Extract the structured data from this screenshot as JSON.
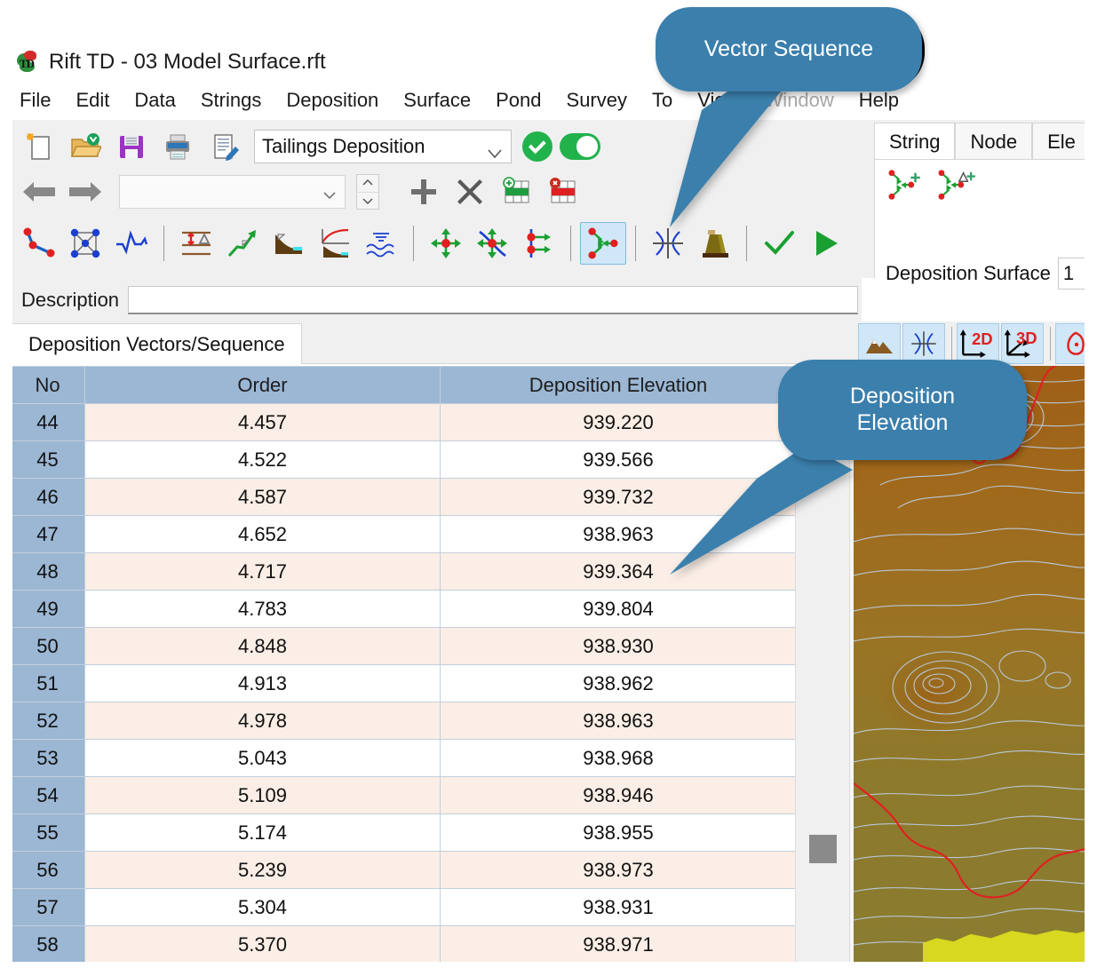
{
  "window": {
    "title": "Rift TD - 03 Model Surface.rft",
    "app_icon": "rift-td-logo-icon"
  },
  "menubar": {
    "items": [
      {
        "label": "File",
        "disabled": false
      },
      {
        "label": "Edit",
        "disabled": false
      },
      {
        "label": "Data",
        "disabled": false
      },
      {
        "label": "Strings",
        "disabled": false
      },
      {
        "label": "Deposition",
        "disabled": false
      },
      {
        "label": "Surface",
        "disabled": false
      },
      {
        "label": "Pond",
        "disabled": false
      },
      {
        "label": "Survey",
        "disabled": false
      },
      {
        "label": "To",
        "disabled": false
      },
      {
        "label": "View",
        "disabled": false
      },
      {
        "label": "Window",
        "disabled": true
      },
      {
        "label": "Help",
        "disabled": false
      }
    ]
  },
  "toolbar": {
    "mode_combo_value": "Tailings Deposition",
    "search_value": "",
    "apply_icon": "green-check-circle-icon",
    "toggle_state_icon": "green-toggle-on-icon",
    "row1_icons": [
      "new-document-icon",
      "open-folder-icon",
      "save-floppy-icon",
      "print-icon",
      "edit-document-icon"
    ],
    "row2_icons": [
      "back-arrow-icon",
      "forward-arrow-icon"
    ],
    "row2_buttons": [
      "add-plus-icon",
      "delete-cross-icon",
      "insert-row-icon",
      "delete-row-icon"
    ],
    "row3_icons": [
      "polyline-string-icon",
      "mesh-network-icon",
      "profile-wave-icon",
      "elevation-range-icon",
      "slope-arrow-icon",
      "beach-profile-icon",
      "beach-curve-icon",
      "water-surface-icon",
      "move-vector-icon",
      "move-vector-string-icon",
      "vector-offsets-icon",
      "vector-sequence-icon",
      "intersect-icon",
      "tailings-dam-icon",
      "check-icon",
      "run-play-icon"
    ],
    "selected_icon": "vector-sequence-icon"
  },
  "description": {
    "label": "Description",
    "value": "",
    "placeholder": ""
  },
  "tabs": {
    "active": "Deposition Vectors/Sequence"
  },
  "table": {
    "columns": [
      "No",
      "Order",
      "Deposition Elevation"
    ],
    "rows": [
      {
        "no": "44",
        "order": "4.457",
        "elevation": "939.220"
      },
      {
        "no": "45",
        "order": "4.522",
        "elevation": "939.566"
      },
      {
        "no": "46",
        "order": "4.587",
        "elevation": "939.732"
      },
      {
        "no": "47",
        "order": "4.652",
        "elevation": "938.963"
      },
      {
        "no": "48",
        "order": "4.717",
        "elevation": "939.364"
      },
      {
        "no": "49",
        "order": "4.783",
        "elevation": "939.804"
      },
      {
        "no": "50",
        "order": "4.848",
        "elevation": "938.930"
      },
      {
        "no": "51",
        "order": "4.913",
        "elevation": "938.962"
      },
      {
        "no": "52",
        "order": "4.978",
        "elevation": "938.963"
      },
      {
        "no": "53",
        "order": "5.043",
        "elevation": "938.968"
      },
      {
        "no": "54",
        "order": "5.109",
        "elevation": "938.946"
      },
      {
        "no": "55",
        "order": "5.174",
        "elevation": "938.955"
      },
      {
        "no": "56",
        "order": "5.239",
        "elevation": "938.973"
      },
      {
        "no": "57",
        "order": "5.304",
        "elevation": "938.931"
      },
      {
        "no": "58",
        "order": "5.370",
        "elevation": "938.971"
      }
    ]
  },
  "right_panel": {
    "tabs": [
      {
        "label": "String",
        "active": true
      },
      {
        "label": "Node",
        "active": false
      },
      {
        "label": "Ele",
        "active": false
      }
    ],
    "icons": [
      "vector-sequence-add-icon",
      "vector-sequence-delta-add-icon"
    ],
    "field_label": "Deposition Surface",
    "field_value": "1"
  },
  "view_toolbar": {
    "buttons": [
      {
        "name": "surface-terrain-icon",
        "label": "",
        "active": true
      },
      {
        "name": "intersect-icon",
        "label": "",
        "active": true
      },
      {
        "name": "view-2d-icon",
        "label": "2D",
        "active": true
      },
      {
        "name": "view-3d-icon",
        "label": "3D",
        "active": true
      },
      {
        "name": "rotate-view-icon",
        "label": "",
        "active": true
      }
    ]
  },
  "callouts": [
    {
      "id": "vector-sequence",
      "text": "Vector Sequence",
      "color": "#3b7fac",
      "text_color": "#ffffff"
    },
    {
      "id": "deposition-elevation",
      "line1": "Deposition",
      "line2": "Elevation",
      "color": "#3b7fac",
      "text_color": "#ffffff"
    }
  ],
  "map": {
    "name": "deposition-surface-terrain-map",
    "contour_color": "#b9c8d6",
    "boundary_color": "#e02020",
    "fill_zone_color": "#d7d81f"
  },
  "colors": {
    "header_blue": "#9bb7d4",
    "row_alt": "#faeee6",
    "accent_green": "#22b24c",
    "callout_blue": "#3b7fac",
    "selection_blue": "#cfe7f7"
  }
}
